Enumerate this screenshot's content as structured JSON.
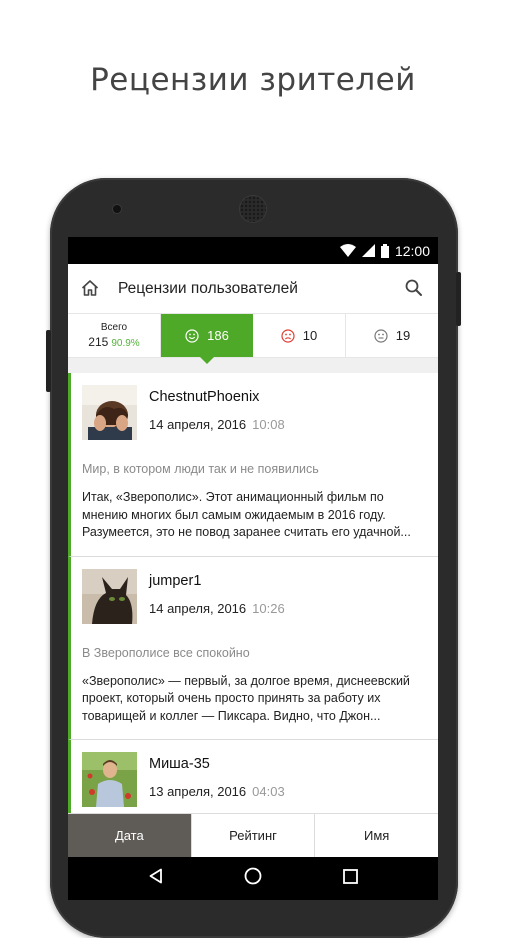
{
  "promo": {
    "title": "Рецензии зрителей"
  },
  "status_bar": {
    "time": "12:00"
  },
  "app_bar": {
    "title": "Рецензии пользователей"
  },
  "filters": {
    "total_label": "Всего",
    "total_count": "215",
    "total_percent": "90.9%",
    "positive": "186",
    "negative": "10",
    "neutral": "19"
  },
  "reviews": [
    {
      "author": "ChestnutPhoenix",
      "date": "14 апреля, 2016",
      "time": "10:08",
      "title": "Мир, в котором люди так и не появились",
      "text": "Итак, «Зверополис». Этот анимационный фильм по мнению многих был самым ожидаемым в 2016 году. Разумеется, это не повод заранее считать его удачной..."
    },
    {
      "author": "jumper1",
      "date": "14 апреля, 2016",
      "time": "10:26",
      "title": "В Зверополисе все спокойно",
      "text": "«Зверополис» — первый, за долгое время, диснеевский проект, который очень просто принять за работу их товарищей и коллег — Пиксара. Видно, что Джон..."
    },
    {
      "author": "Миша-35",
      "date": "13 апреля, 2016",
      "time": "04:03",
      "title": "",
      "text": ""
    }
  ],
  "sort_tabs": {
    "date": "Дата",
    "rating": "Рейтинг",
    "name": "Имя"
  },
  "colors": {
    "accent": "#4fa928",
    "active_tab": "#5f5b57"
  }
}
